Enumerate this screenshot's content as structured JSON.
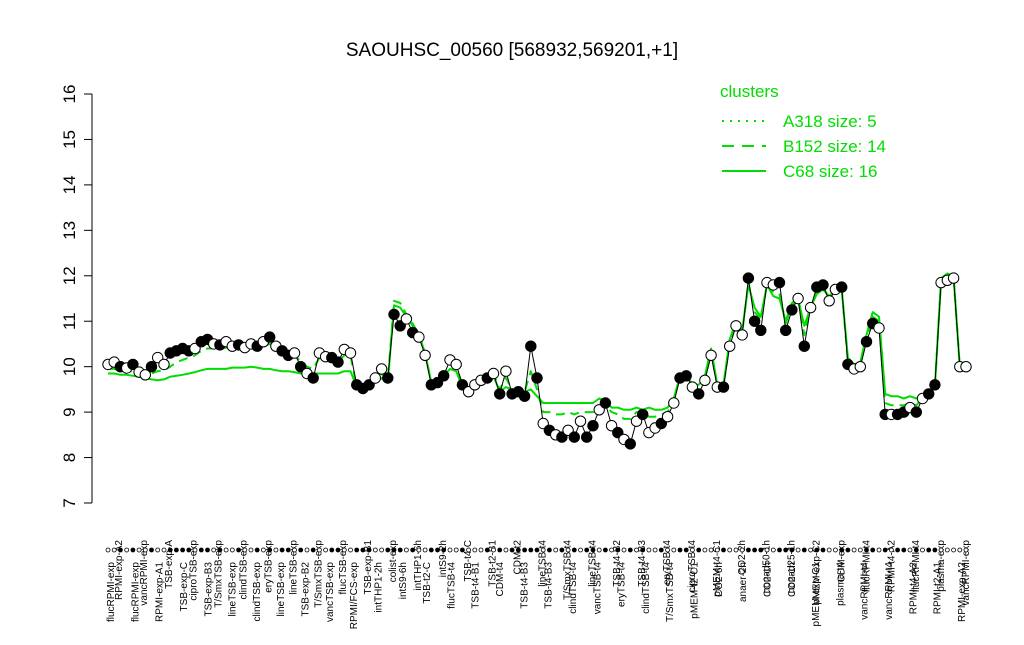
{
  "chart_data": {
    "type": "line",
    "title": "SAOUHSC_00560 [568932,569201,+1]",
    "xlabel": "",
    "ylabel": "",
    "ylim": [
      7,
      16
    ],
    "yticks": [
      7,
      8,
      9,
      10,
      11,
      12,
      13,
      14,
      15,
      16
    ],
    "grid": false,
    "legend_position": "top-right",
    "legend_title": "clusters",
    "legend": [
      {
        "name": "A318 size: 5",
        "style": "dotted",
        "color": "#00dd00"
      },
      {
        "name": "B152 size: 14",
        "style": "dashed",
        "color": "#00dd00"
      },
      {
        "name": "C68 size: 16",
        "style": "solid",
        "color": "#00dd00"
      }
    ],
    "top_labels": [
      "RPMI-exp-A2",
      "vancRPMI-exp",
      "TSB-exp-A",
      "ciproTSB-exp",
      "T/SmxTSB-exp",
      "clindTSB-exp",
      "eryTSB-exp",
      "lineTSB-exp",
      "T/SmxTSB-exp",
      "flucTSB-exp",
      "TSB-exp-B1",
      "colist-exp",
      "intTHP1-6h",
      "intS9-2h",
      "TSB-t4-C",
      "TSB-t2-B1",
      "CDM-t2",
      "lineTSB-t4",
      "T/SmxTSB-t4",
      "lineTSB-t4",
      "TSB-t4-B2",
      "TSB-t4-B3",
      "eryTSB-t4",
      "ciproTSB-t4",
      "pMEM-t4-C1",
      "CO2-2h",
      "nonad50-1h",
      "nonad25-1h",
      "pMEM-exp-C2",
      "CDM-exp",
      "flucRPMI-t4",
      "RPMI-t4-A2",
      "flucRPMI-t4",
      "plasma-exp",
      "vancRPMI-exp"
    ],
    "bottom_labels": [
      "flucRPMI-exp",
      "flucRPMI-exp",
      "RPMI-exp-A1",
      "TSB-exp-C",
      "TSB-exp-B3",
      "lineTSB-exp",
      "clindTSB-exp",
      "lineTSB-exp",
      "TSB-exp-B2",
      "vancTSB-exp",
      "RPMI/FCS-exp",
      "intTHP1-2h",
      "intS9-6h",
      "TSB-t2-C",
      "flucTSB-t4",
      "TSB-t4-B1",
      "CDM-t4",
      "TSB-t4-B3",
      "TSB-t4-B3",
      "clindTSB-t4",
      "vancTSB-t4",
      "eryTSB-t4",
      "clindTSB-t4",
      "T/SmxTSB-t4",
      "pMEM-t2-C1",
      "CO2-6h",
      "anaer-2h",
      "CO2-1h",
      "CO2-1h",
      "pMEM-exp-C1",
      "plasma-t4",
      "vancRPMI-t4",
      "vancRPMI-t4",
      "RPMI-t4-A2",
      "RPMI-t2-A1",
      "RPMI-exp-A2"
    ],
    "n_points": 133,
    "series": [
      {
        "name": "Values",
        "values": [
          10.05,
          10.1,
          10.0,
          9.97,
          10.05,
          9.88,
          9.82,
          10.0,
          10.2,
          10.05,
          10.3,
          10.35,
          10.4,
          10.35,
          10.4,
          10.55,
          10.6,
          10.5,
          10.48,
          10.55,
          10.45,
          10.48,
          10.42,
          10.5,
          10.45,
          10.55,
          10.65,
          10.45,
          10.35,
          10.25,
          10.3,
          10.0,
          9.85,
          9.75,
          10.3,
          10.22,
          10.2,
          10.1,
          10.38,
          10.3,
          9.6,
          9.52,
          9.6,
          9.75,
          9.95,
          9.75,
          11.15,
          10.9,
          11.05,
          10.75,
          10.65,
          10.25,
          9.6,
          9.65,
          9.8,
          10.15,
          10.05,
          9.6,
          9.45,
          9.6,
          9.7,
          9.75,
          9.85,
          9.4,
          9.9,
          9.4,
          9.45,
          9.35,
          10.45,
          9.75,
          8.75,
          8.6,
          8.5,
          8.45,
          8.6,
          8.45,
          8.8,
          8.45,
          8.7,
          9.05,
          9.2,
          8.7,
          8.55,
          8.4,
          8.3,
          8.8,
          8.95,
          8.55,
          8.65,
          8.75,
          8.9,
          9.2,
          9.75,
          9.8,
          9.55,
          9.4,
          9.7,
          10.25,
          9.55,
          9.55,
          10.45,
          10.9,
          10.7,
          11.95,
          11.0,
          10.8,
          11.85,
          11.8,
          11.85,
          10.8,
          11.25,
          11.5,
          10.45,
          11.3,
          11.75,
          11.8,
          11.45,
          11.7,
          11.75,
          10.05,
          9.95,
          10.0,
          10.55,
          10.95,
          10.85,
          8.95,
          8.95,
          8.95,
          9.0,
          9.1,
          9.0,
          9.3,
          9.4,
          9.6,
          11.85,
          11.9,
          11.95,
          10.0,
          10.0
        ],
        "marker_fill": [
          "w",
          "w",
          "b",
          "w",
          "b",
          "w",
          "w",
          "b",
          "w",
          "w",
          "b",
          "b",
          "b",
          "b",
          "w",
          "b",
          "b",
          "w",
          "b",
          "w",
          "w",
          "b",
          "w",
          "w",
          "b",
          "w",
          "b",
          "w",
          "b",
          "b",
          "w",
          "b",
          "w",
          "b",
          "w",
          "w",
          "b",
          "b",
          "w",
          "w",
          "b",
          "b",
          "b",
          "w",
          "w",
          "b",
          "b",
          "b",
          "w",
          "b",
          "w",
          "w",
          "b",
          "b",
          "b",
          "w",
          "w",
          "b",
          "w",
          "w",
          "w",
          "b",
          "w",
          "b",
          "w",
          "b",
          "b",
          "b",
          "b",
          "b",
          "w",
          "b",
          "w",
          "b",
          "w",
          "b",
          "w",
          "b",
          "b",
          "w",
          "b",
          "w",
          "b",
          "w",
          "b",
          "w",
          "b",
          "w",
          "w",
          "b",
          "w",
          "w",
          "b",
          "b",
          "w",
          "b",
          "w",
          "w",
          "w",
          "b",
          "w",
          "w",
          "w",
          "b",
          "b",
          "b",
          "w",
          "w",
          "b",
          "b",
          "b",
          "w",
          "b",
          "w",
          "b",
          "b",
          "w",
          "w",
          "b",
          "b",
          "w",
          "w",
          "b",
          "b",
          "w",
          "b",
          "w",
          "b",
          "b",
          "w",
          "b",
          "w",
          "b",
          "b",
          "w",
          "w",
          "w",
          "w",
          "w",
          "w"
        ]
      },
      {
        "name": "C68 size: 16",
        "values": [
          9.85,
          9.85,
          9.82,
          9.82,
          9.8,
          9.78,
          9.75,
          9.72,
          9.7,
          9.72,
          9.78,
          9.8,
          9.82,
          9.85,
          9.88,
          9.92,
          9.95,
          9.95,
          9.95,
          9.95,
          9.98,
          9.98,
          9.98,
          10.0,
          9.98,
          9.95,
          9.95,
          9.92,
          9.9,
          9.9,
          9.88,
          9.85,
          9.85,
          9.85,
          9.85,
          9.85,
          9.85,
          9.85,
          9.9,
          9.9,
          9.55,
          9.52,
          9.55,
          9.65,
          9.75,
          9.65,
          11.35,
          11.3,
          11.1,
          10.9,
          10.7,
          10.3,
          9.65,
          9.68,
          9.8,
          9.95,
          9.9,
          9.55,
          9.5,
          9.55,
          9.65,
          9.75,
          9.8,
          9.45,
          9.55,
          9.5,
          9.5,
          9.45,
          9.5,
          9.35,
          9.2,
          9.2,
          9.2,
          9.2,
          9.2,
          9.2,
          9.2,
          9.2,
          9.2,
          9.3,
          9.25,
          9.1,
          9.1,
          9.05,
          9.05,
          9.1,
          9.05,
          9.1,
          9.05,
          9.05,
          9.1,
          9.3,
          9.8,
          9.85,
          9.6,
          9.6,
          9.8,
          10.4,
          9.6,
          9.6,
          10.6,
          11.0,
          10.8,
          11.8,
          11.3,
          11.1,
          11.8,
          11.55,
          11.5,
          11.0,
          11.4,
          11.5,
          10.9,
          11.3,
          11.6,
          11.7,
          11.55,
          11.7,
          11.7,
          10.2,
          10.05,
          10.1,
          10.7,
          11.2,
          11.1,
          9.4,
          9.35,
          9.35,
          9.3,
          9.35,
          9.3,
          9.35,
          9.4,
          9.55,
          11.95,
          12.05,
          12.0,
          10.0,
          9.9
        ]
      },
      {
        "name": "B152 size: 14",
        "values": [
          9.95,
          9.95,
          9.92,
          9.9,
          9.9,
          9.85,
          9.82,
          9.85,
          9.9,
          9.92,
          10.0,
          10.1,
          10.15,
          10.2,
          10.25,
          10.35,
          10.4,
          10.4,
          10.4,
          10.42,
          10.4,
          10.4,
          10.4,
          10.42,
          10.45,
          10.45,
          10.5,
          10.42,
          10.35,
          10.3,
          10.28,
          10.1,
          10.0,
          9.95,
          10.2,
          10.2,
          10.15,
          10.1,
          10.25,
          10.25,
          9.55,
          9.52,
          9.58,
          9.7,
          9.85,
          9.7,
          11.45,
          11.4,
          11.15,
          10.95,
          10.7,
          10.3,
          9.65,
          9.7,
          9.85,
          10.05,
          10.0,
          9.6,
          9.55,
          9.6,
          9.7,
          9.8,
          9.85,
          9.5,
          9.75,
          9.5,
          9.5,
          9.45,
          9.9,
          9.5,
          9.0,
          9.0,
          8.95,
          8.95,
          9.0,
          8.95,
          9.0,
          9.0,
          9.0,
          9.15,
          9.15,
          9.0,
          8.95,
          8.85,
          8.85,
          9.0,
          9.0,
          8.9,
          8.9,
          8.95,
          9.0,
          9.25,
          9.8,
          9.85,
          9.6,
          9.55,
          9.75,
          10.3,
          9.6,
          9.6,
          10.5,
          10.95,
          10.75,
          11.85,
          11.2,
          11.05,
          11.8,
          11.65,
          11.6,
          10.95,
          11.35,
          11.5,
          10.7,
          11.3,
          11.65,
          11.75,
          11.5,
          11.7,
          11.7,
          10.1,
          10.0,
          10.05,
          10.6,
          11.1,
          11.0,
          9.2,
          9.15,
          9.15,
          9.15,
          9.2,
          9.15,
          9.3,
          9.4,
          9.55,
          11.9,
          12.0,
          11.95,
          10.0,
          9.95
        ]
      }
    ]
  }
}
